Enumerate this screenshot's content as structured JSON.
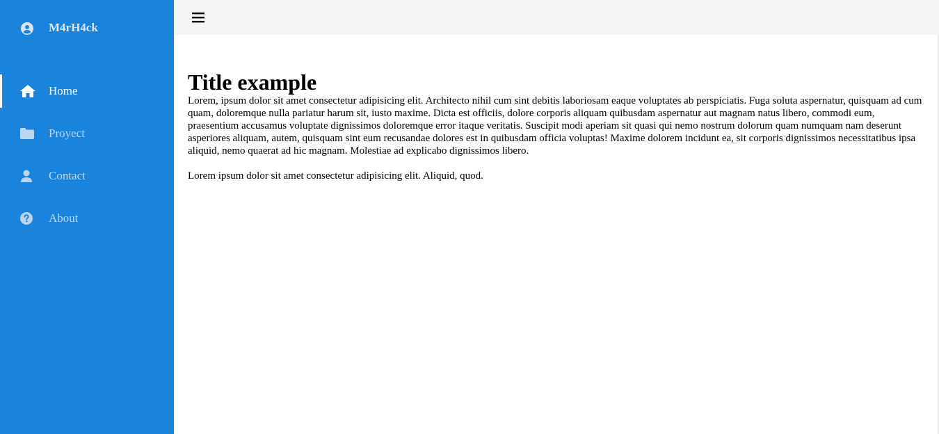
{
  "brand": {
    "name": "M4rH4ck",
    "icon": "user-circle-icon"
  },
  "sidebar": {
    "items": [
      {
        "label": "Home",
        "icon": "home-icon",
        "active": true
      },
      {
        "label": "Proyect",
        "icon": "folder-icon",
        "active": false
      },
      {
        "label": "Contact",
        "icon": "user-icon",
        "active": false
      },
      {
        "label": "About",
        "icon": "question-circle-icon",
        "active": false
      }
    ]
  },
  "topbar": {
    "menu_icon": "hamburger-menu-icon"
  },
  "main": {
    "title": "Title example",
    "paragraph1": "Lorem, ipsum dolor sit amet consectetur adipisicing elit. Architecto nihil cum sint debitis laboriosam eaque voluptates ab perspiciatis. Fuga soluta aspernatur, quisquam ad cum quam, doloremque nulla pariatur harum sit, iusto maxime. Dicta est officiis, dolore corporis aliquam quibusdam aspernatur aut magnam natus libero, commodi eum, praesentium accusamus voluptate dignissimos doloremque error itaque veritatis. Suscipit modi aperiam sit quasi qui nemo nostrum dolorum quam numquam nam deserunt asperiores aliquam, autem, quisquam sint eum recusandae dolores est in quibusdam officia voluptas! Maxime dolorem incidunt ea, sit corporis dignissimos necessitatibus ipsa aliquid, nemo quaerat ad hic magnam. Molestiae ad explicabo dignissimos libero.",
    "paragraph2": "Lorem ipsum dolor sit amet consectetur adipisicing elit. Aliquid, quod."
  },
  "colors": {
    "sidebar_bg": "#1a84dc",
    "topbar_bg": "#f4f4f4",
    "nav_inactive": "#bcd5ec",
    "nav_active": "#ffffff"
  }
}
